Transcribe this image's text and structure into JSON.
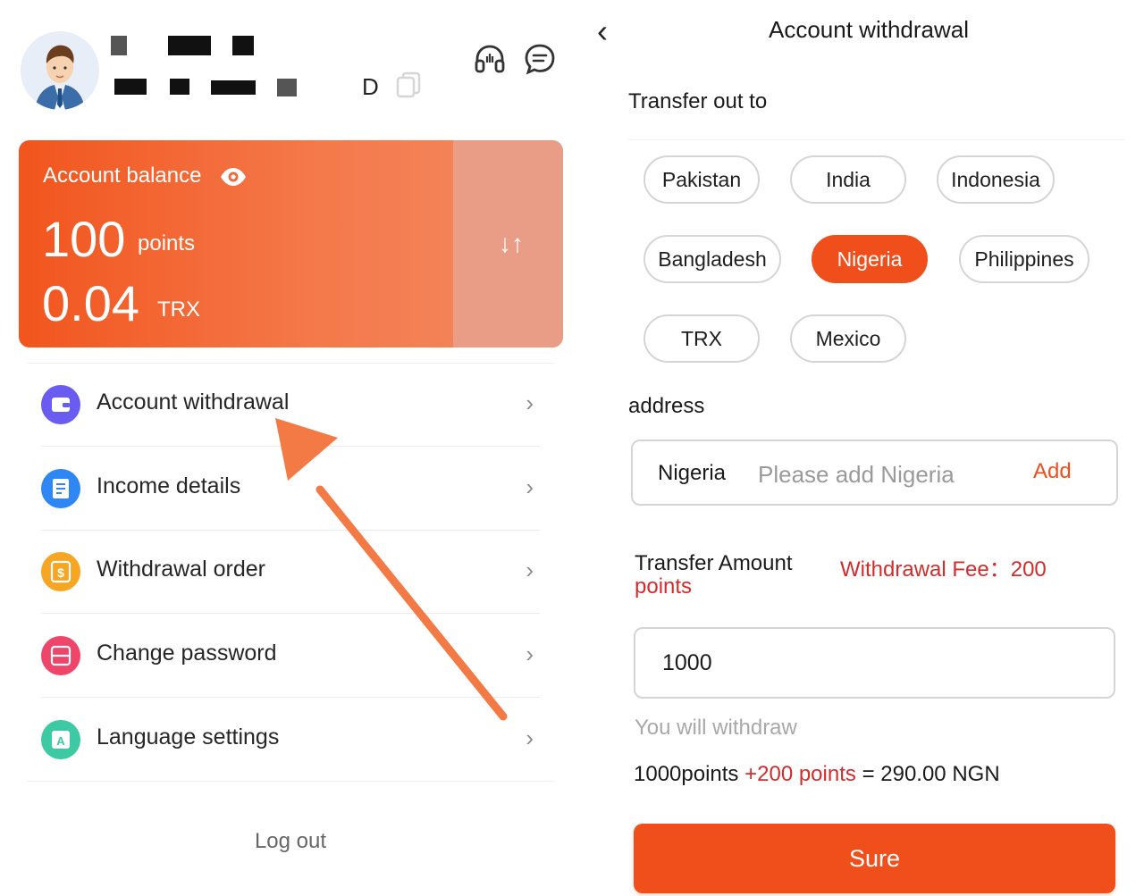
{
  "colors": {
    "accent": "#f04e1b",
    "card_gradient_start": "#f2551d",
    "card_side": "#e99c86",
    "fee_red": "#d42c2c",
    "arrow": "#f47a45"
  },
  "profile": {
    "avatar_icon": "user-avatar",
    "partial_id_char": "D",
    "copy_icon": "copy-icon",
    "support_icon": "headset-icon",
    "message_icon": "chat-icon"
  },
  "balance": {
    "label": "Account balance",
    "eye_icon": "eye-icon",
    "points_value": "100",
    "points_unit": "points",
    "trx_value": "0.04",
    "trx_unit": "TRX",
    "swap_symbol": "↓↑"
  },
  "menu": {
    "items": [
      {
        "label": "Account withdrawal",
        "icon": "wallet-icon",
        "color": "#6a5cf0"
      },
      {
        "label": "Income details",
        "icon": "document-icon",
        "color": "#2f86f5"
      },
      {
        "label": "Withdrawal order",
        "icon": "dollar-icon",
        "color": "#f6a623"
      },
      {
        "label": "Change password",
        "icon": "lock-icon",
        "color": "#f0456b"
      },
      {
        "label": "Language settings",
        "icon": "language-icon",
        "color": "#3cc9a3"
      }
    ],
    "chevron": "›",
    "logout": "Log out"
  },
  "withdraw": {
    "back_symbol": "‹",
    "title": "Account withdrawal",
    "transfer_out_to": "Transfer out to",
    "countries": [
      "Pakistan",
      "India",
      "Indonesia",
      "Bangladesh",
      "Nigeria",
      "Philippines",
      "TRX",
      "Mexico"
    ],
    "selected_country": "Nigeria",
    "address_label": "address",
    "address_country": "Nigeria",
    "address_placeholder": "Please add Nigeria",
    "address_add": "Add",
    "transfer_amount_label": "Transfer Amount",
    "fee_label": "Withdrawal Fee：200",
    "fee_unit": "points",
    "amount_value": "1000",
    "you_will_withdraw": "You will withdraw",
    "calc_base": "1000points",
    "calc_fee": "+200 points",
    "calc_result": "= 290.00 NGN",
    "submit": "Sure"
  }
}
